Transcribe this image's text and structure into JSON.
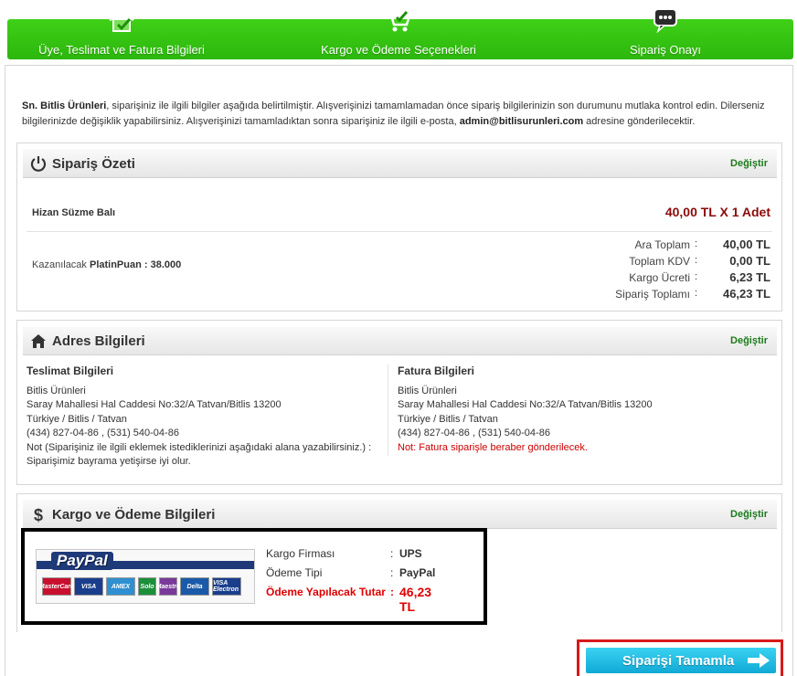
{
  "steps": [
    {
      "label": "Üye, Teslimat ve Fatura Bilgileri",
      "icon": "home-check-icon"
    },
    {
      "label": "Kargo ve Ödeme Seçenekleri",
      "icon": "cart-check-icon"
    },
    {
      "label": "Sipariş Onayı",
      "icon": "speech-bubble-icon"
    }
  ],
  "intro": {
    "customer": "Sn. Bitlis Ürünleri",
    "text1": ", siparişiniz ile ilgili bilgiler aşağıda belirtilmiştir. Alışverişinizi tamamlamadan önce sipariş bilgilerinizin son durumunu mutlaka kontrol edin. Dilerseniz bilgilerinizde değişiklik yapabilirsiniz. Alışverişinizi tamamladıktan sonra siparişiniz ile ilgili e-posta, ",
    "email": "admin@bitlisurunleri.com",
    "text2": " adresine gönderilecektir."
  },
  "order_summary": {
    "title": "Sipariş Özeti",
    "change": "Değiştir",
    "product_name": "Hizan Süzme Balı",
    "product_price": "40,00 TL X 1 Adet",
    "points_label": "Kazanılacak ",
    "points_name": "PlatinPuan : 38.000",
    "totals": [
      {
        "label": "Ara Toplam",
        "value": "40,00 TL"
      },
      {
        "label": "Toplam KDV",
        "value": "0,00 TL"
      },
      {
        "label": "Kargo Ücreti",
        "value": "6,23 TL"
      },
      {
        "label": "Sipariş Toplamı",
        "value": "46,23 TL"
      }
    ]
  },
  "address": {
    "title": "Adres Bilgileri",
    "change": "Değiştir",
    "shipping": {
      "title": "Teslimat Bilgileri",
      "lines": [
        "Bitlis Ürünleri",
        "Saray Mahallesi Hal Caddesi No:32/A Tatvan/Bitlis 13200",
        "Türkiye / Bitlis / Tatvan",
        "(434) 827-04-86 , (531) 540-04-86",
        "Not (Siparişiniz ile ilgili eklemek istediklerinizi aşağıdaki alana yazabilirsiniz.) :",
        "Siparişimiz bayrama yetişirse iyi olur."
      ]
    },
    "billing": {
      "title": "Fatura Bilgileri",
      "lines": [
        "Bitlis Ürünleri",
        "Saray Mahallesi Hal Caddesi No:32/A Tatvan/Bitlis 13200",
        "Türkiye / Bitlis / Tatvan",
        "(434) 827-04-86 , (531) 540-04-86"
      ],
      "note": "Not: Fatura siparişle beraber gönderilecek."
    }
  },
  "payment": {
    "title": "Kargo ve Ödeme Bilgileri",
    "change": "Değiştir",
    "paypal_logo": "PayPal",
    "cards": [
      {
        "label": "MasterCard",
        "color": "#c8102e"
      },
      {
        "label": "VISA",
        "color": "#1a3e8c"
      },
      {
        "label": "AMEX",
        "color": "#2f8fd0"
      },
      {
        "label": "Solo",
        "color": "#1c8f3a"
      },
      {
        "label": "Maestro",
        "color": "#7a3a99"
      },
      {
        "label": "Delta",
        "color": "#1a5aa8"
      },
      {
        "label": "VISA Electron",
        "color": "#1a3e8c"
      }
    ],
    "rows": [
      {
        "label": "Kargo Firması",
        "value": "UPS"
      },
      {
        "label": "Ödeme Tipi",
        "value": "PayPal"
      }
    ],
    "total_label": "Ödeme Yapılacak Tutar",
    "total_value": "46,23 TL"
  },
  "complete_button": "Siparişi Tamamla",
  "colors": {
    "header_green": "#2cb70c",
    "link_green": "#1d7a1d",
    "price_red": "#8b0a0a",
    "button_blue": "#11a9d6"
  }
}
